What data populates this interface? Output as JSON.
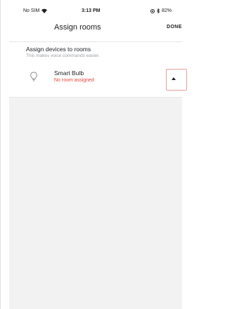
{
  "status_bar": {
    "carrier": "No SIM",
    "time": "3:13 PM",
    "battery": "82%"
  },
  "header": {
    "title": "Assign rooms",
    "done_label": "DONE"
  },
  "section": {
    "title": "Assign devices to rooms",
    "subtitle": "This makes voice commands easier."
  },
  "devices": [
    {
      "name": "Smart Bulb",
      "status": "No room assigned",
      "icon": "lightbulb-icon"
    }
  ],
  "colors": {
    "error": "#e8453c",
    "background": "#f2f2f2"
  }
}
